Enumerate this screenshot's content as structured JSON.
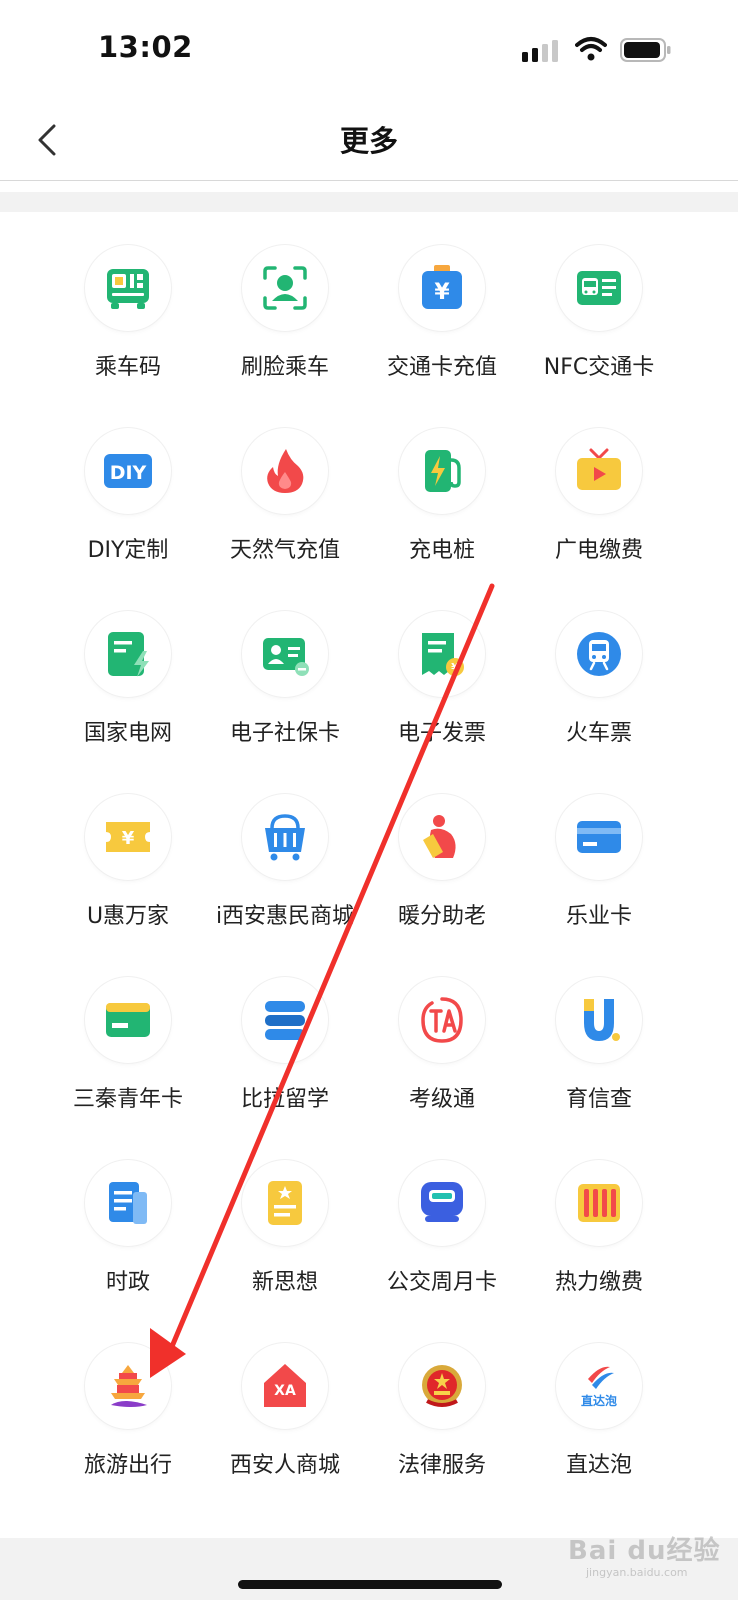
{
  "status_bar": {
    "time": "13:02"
  },
  "header": {
    "title": "更多",
    "back_icon": "chevron-left-icon"
  },
  "grid": [
    {
      "label": "乘车码",
      "icon": "bus-qr-icon"
    },
    {
      "label": "刷脸乘车",
      "icon": "face-scan-icon"
    },
    {
      "label": "交通卡充值",
      "icon": "yuan-card-icon"
    },
    {
      "label": "NFC交通卡",
      "icon": "nfc-bus-card-icon"
    },
    {
      "label": "DIY定制",
      "icon": "diy-icon"
    },
    {
      "label": "天然气充值",
      "icon": "flame-icon"
    },
    {
      "label": "充电桩",
      "icon": "charging-pile-icon"
    },
    {
      "label": "广电缴费",
      "icon": "tv-icon"
    },
    {
      "label": "国家电网",
      "icon": "state-grid-icon"
    },
    {
      "label": "电子社保卡",
      "icon": "social-security-card-icon"
    },
    {
      "label": "电子发票",
      "icon": "e-invoice-icon"
    },
    {
      "label": "火车票",
      "icon": "train-icon"
    },
    {
      "label": "U惠万家",
      "icon": "coupon-icon"
    },
    {
      "label": "i西安惠民商城",
      "icon": "shopping-basket-icon"
    },
    {
      "label": "暖分助老",
      "icon": "elderly-care-icon"
    },
    {
      "label": "乐业卡",
      "icon": "bank-card-icon"
    },
    {
      "label": "三秦青年卡",
      "icon": "youth-card-icon"
    },
    {
      "label": "比拉留学",
      "icon": "study-abroad-icon"
    },
    {
      "label": "考级通",
      "icon": "exam-icon"
    },
    {
      "label": "育信查",
      "icon": "education-check-icon"
    },
    {
      "label": "时政",
      "icon": "news-icon"
    },
    {
      "label": "新思想",
      "icon": "thought-document-icon"
    },
    {
      "label": "公交周月卡",
      "icon": "bus-pass-icon"
    },
    {
      "label": "热力缴费",
      "icon": "radiator-icon"
    },
    {
      "label": "旅游出行",
      "icon": "pagoda-travel-icon"
    },
    {
      "label": "西安人商城",
      "icon": "xa-house-icon"
    },
    {
      "label": "法律服务",
      "icon": "emblem-icon"
    },
    {
      "label": "直达泡",
      "icon": "zhidapao-logo-icon"
    }
  ],
  "icon_texts": {
    "diy": "DIY",
    "yuan": "¥",
    "xa": "XA",
    "zhidapao": "直达泡"
  },
  "watermark": {
    "main": "Bai du经验",
    "sub": "jingyan.baidu.com"
  },
  "colors": {
    "green": "#22b573",
    "blue": "#2f8ae8",
    "yellow": "#f7c93e",
    "red": "#f2494a",
    "arrow": "#f0302b"
  }
}
